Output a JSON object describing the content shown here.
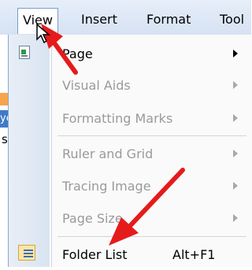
{
  "menubar": {
    "view": "View",
    "insert": "Insert",
    "format": "Format",
    "tools": "Tool"
  },
  "left_edge": {
    "blue_fragment": "ye",
    "s_fragment": "s"
  },
  "menu": {
    "items": [
      {
        "label": "Page",
        "enabled": true,
        "has_submenu": true
      },
      {
        "label": "Visual Aids",
        "enabled": false,
        "has_submenu": true
      },
      {
        "label": "Formatting Marks",
        "enabled": false,
        "has_submenu": true
      },
      {
        "label": "Ruler and Grid",
        "enabled": false,
        "has_submenu": true
      },
      {
        "label": "Tracing Image",
        "enabled": false,
        "has_submenu": true
      },
      {
        "label": "Page Size",
        "enabled": false,
        "has_submenu": true
      },
      {
        "label": "Folder List",
        "enabled": true,
        "has_submenu": false,
        "shortcut": "Alt+F1"
      }
    ]
  },
  "colors": {
    "annotation_arrow": "#e51b1b",
    "menu_border": "#8aa6ca",
    "disabled_text": "#9a9a9a"
  }
}
